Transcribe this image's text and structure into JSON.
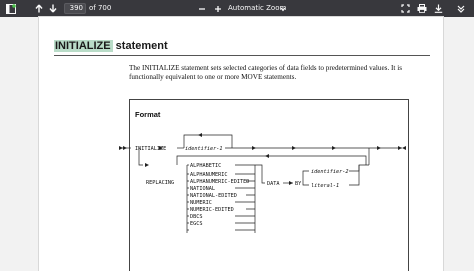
{
  "toolbar": {
    "page_number": "390",
    "page_count_label": "of 700",
    "zoom_label": "Automatic Zoom",
    "icons": [
      "sidebar-toggle-icon",
      "previous-page-icon",
      "next-page-icon",
      "zoom-out-icon",
      "zoom-in-icon",
      "zoom-dropdown-icon",
      "presentation-mode-icon",
      "print-icon",
      "download-icon",
      "tools-menu-icon"
    ]
  },
  "document": {
    "title_highlight": "INITIALIZE",
    "title_rest": " statement",
    "description": "The INITIALIZE statement sets selected categories of data fields to predetermined values. It is functionally equivalent to one or more MOVE statements.",
    "format_heading": "Format",
    "syntax": {
      "keyword_initialize": "INITIALIZE",
      "identifier_1": "identifier-1",
      "keyword_replacing": "REPLACING",
      "categories": [
        "ALPHABETIC",
        "ALPHANUMERIC",
        "ALPHANUMERIC-EDITED",
        "NATIONAL",
        "NATIONAL-EDITED",
        "NUMERIC",
        "NUMERIC-EDITED",
        "DBCS",
        "EGCS"
      ],
      "keyword_data": "DATA",
      "keyword_by": "BY",
      "identifier_2": "identifier-2",
      "literal_1": "literal-1"
    }
  },
  "colors": {
    "toolbar": "#38383d",
    "highlight": "#b9dcc8",
    "page": "#ffffff",
    "background": "#f2f2f2"
  }
}
